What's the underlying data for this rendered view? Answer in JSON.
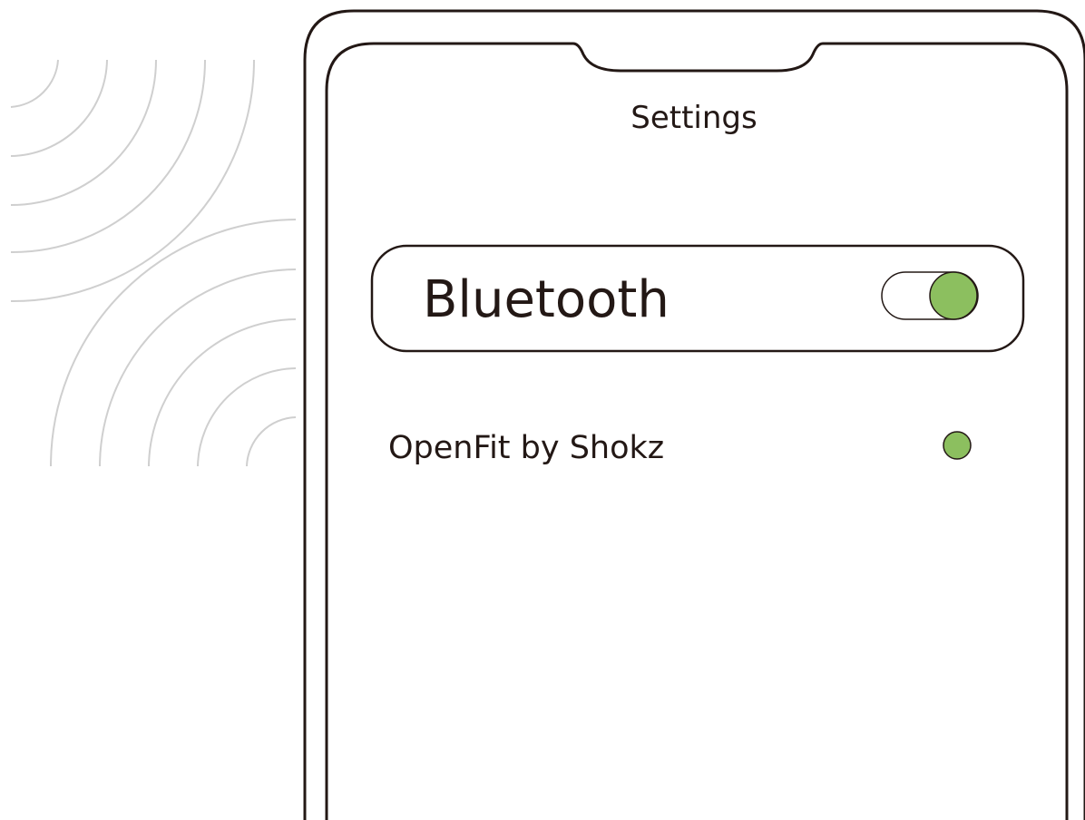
{
  "screen": {
    "title": "Settings"
  },
  "bluetooth": {
    "label": "Bluetooth",
    "enabled": true
  },
  "devices": [
    {
      "name": "OpenFit by Shokz",
      "status": "connected"
    }
  ],
  "colors": {
    "accent": "#8cbf5f",
    "outline": "#231815",
    "decor": "#c9c9c9"
  },
  "icons": {
    "decor": "signal-waves-icon",
    "status": "connected-dot-icon"
  }
}
